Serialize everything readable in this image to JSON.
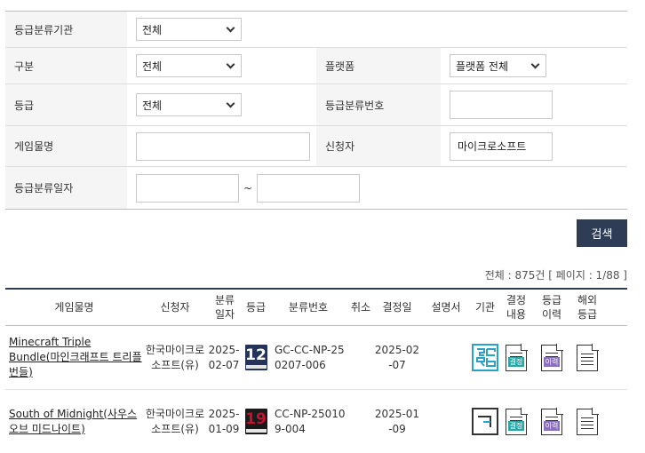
{
  "form": {
    "agency_label": "등급분류기관",
    "agency_value": "전체",
    "category_label": "구분",
    "category_value": "전체",
    "platform_label": "플랫폼",
    "platform_value": "플랫폼 전체",
    "grade_label": "등급",
    "grade_value": "전체",
    "classno_label": "등급분류번호",
    "classno_value": "",
    "title_label": "게임물명",
    "title_value": "",
    "applicant_label": "신청자",
    "applicant_value": "마이크로소프트",
    "date_label": "등급분류일자",
    "date_from": "",
    "date_sep": "~",
    "date_to": ""
  },
  "search_button": "검색",
  "summary": "전체 : 875건 [ 페이지 : 1/88 ]",
  "table": {
    "headers": {
      "title": "게임물명",
      "applicant": "신청자",
      "date": "분류\n일자",
      "grade": "등급",
      "classno": "분류번호",
      "cancel": "취소",
      "decision_date": "결정일",
      "manual": "설명서",
      "agency": "기관",
      "decision_content": "결정\n내용",
      "grade_history": "등급\n이력",
      "overseas": "해외\n등급"
    },
    "rows": [
      {
        "title": "Minecraft Triple Bundle(마인크래프트 트리플 번들)",
        "applicant": "한국마이크로소프트(유)",
        "date": "2025-02-07",
        "grade": "12",
        "classno": "GC-CC-NP-250207-006",
        "cancel": "",
        "decision_date": "2025-02-07",
        "manual": "",
        "agency_icon": "gcrb-logo-icon",
        "decision_tag": "결정",
        "history_tag": "이력"
      },
      {
        "title": "South of Midnight(사우스 오브 미드나이트)",
        "applicant": "한국마이크로소프트(유)",
        "date": "2025-01-09",
        "grade": "19",
        "classno": "CC-NP-250109-004",
        "cancel": "",
        "decision_date": "2025-01-09",
        "manual": "",
        "agency_icon": "grac-logo-icon",
        "decision_tag": "결정",
        "history_tag": "이력"
      }
    ]
  },
  "colors": {
    "button_bg": "#2e3c55",
    "label_bg": "#f5f5f5",
    "teal": "#2aa8a8",
    "purple": "#8a6fc0"
  }
}
